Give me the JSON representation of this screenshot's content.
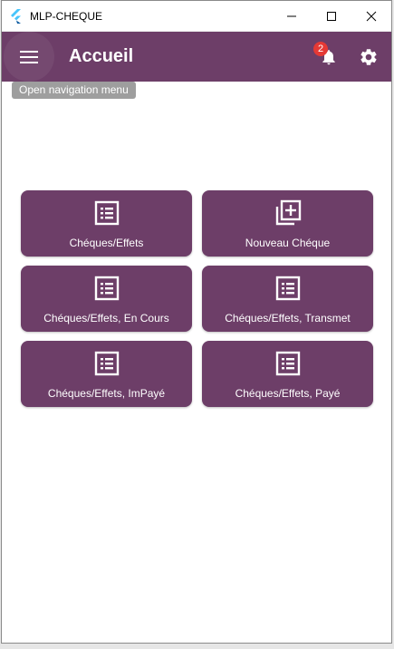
{
  "window": {
    "title": "MLP-CHEQUE"
  },
  "appbar": {
    "title": "Accueil",
    "notification_count": "2",
    "menu_tooltip": "Open navigation menu"
  },
  "tiles": [
    {
      "label": "Chéques/Effets",
      "icon": "list-icon"
    },
    {
      "label": "Nouveau Chéque",
      "icon": "library-add-icon"
    },
    {
      "label": "Chéques/Effets, En Cours",
      "icon": "list-icon"
    },
    {
      "label": "Chéques/Effets, Transmet",
      "icon": "list-icon"
    },
    {
      "label": "Chéques/Effets, ImPayé",
      "icon": "list-icon"
    },
    {
      "label": "Chéques/Effets, Payé",
      "icon": "list-icon"
    }
  ],
  "colors": {
    "primary": "#6d3e68",
    "badge": "#e53935",
    "tooltip": "#9e9e9e"
  }
}
